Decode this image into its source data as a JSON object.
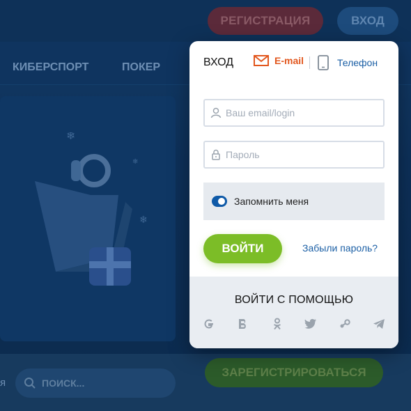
{
  "background": {
    "header": {
      "register_label": "РЕГИСТРАЦИЯ",
      "login_label": "ВХОД"
    },
    "nav": {
      "items": [
        "КИБЕРСПОРТ",
        "ПОКЕР"
      ]
    },
    "bottom": {
      "partial_label": "я",
      "search_placeholder": "ПОИСК...",
      "register_button": "ЗАРЕГИСТРИРОВАТЬСЯ"
    }
  },
  "modal": {
    "title": "ВХОД",
    "tabs": {
      "email": {
        "label": "E-mail",
        "icon": "envelope-icon"
      },
      "phone": {
        "label": "Телефон",
        "icon": "phone-icon"
      }
    },
    "login_field": {
      "placeholder": "Ваш email/login",
      "value": ""
    },
    "password_field": {
      "placeholder": "Пароль",
      "value": ""
    },
    "remember_label": "Запомнить меня",
    "remember_checked": true,
    "submit_label": "ВОЙТИ",
    "forgot_label": "Забыли пароль?",
    "social": {
      "title": "ВОЙТИ С ПОМОЩЬЮ",
      "providers": [
        "google",
        "vk",
        "odnoklassniki",
        "twitter",
        "steam",
        "telegram"
      ]
    }
  },
  "colors": {
    "accent_orange": "#e2571e",
    "link_blue": "#1b5fa5",
    "submit_green": "#7cbd27",
    "toggle_blue": "#0f5aa8"
  }
}
